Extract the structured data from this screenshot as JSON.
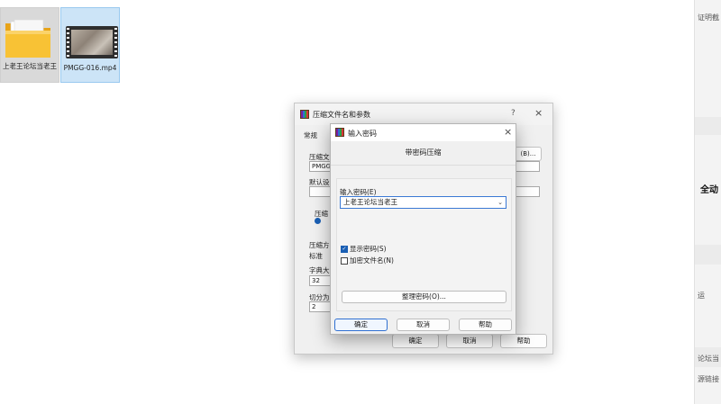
{
  "desktop": {
    "items": [
      {
        "label": "上老王论坛当老王",
        "icon": "folder-icon"
      },
      {
        "label": "PMGG-016.mp4",
        "icon": "video-file-icon"
      }
    ]
  },
  "right_panel": {
    "texts": [
      "证明截",
      "全动",
      "运",
      "论坛当",
      "源链接"
    ]
  },
  "back_dialog": {
    "title": "压缩文件名和参数",
    "help": "?",
    "close": "×",
    "tab": "常规",
    "labels": {
      "archive_name": "压缩文",
      "archive_value": "PMGG-",
      "browse": "(B)...",
      "default": "默认设",
      "format": "压缩",
      "method": "压缩方",
      "method_value": "标准",
      "dict": "字典大",
      "dict_value": "32",
      "split": "切分为",
      "split_value": "2"
    },
    "buttons": {
      "ok": "确定",
      "cancel": "取消",
      "help": "帮助"
    }
  },
  "front_dialog": {
    "title": "输入密码",
    "close": "×",
    "heading": "带密码压缩",
    "password_label": "输入密码(E)",
    "password_value": "上老王论坛当老王",
    "show_password": "显示密码(S)",
    "encrypt_names": "加密文件名(N)",
    "organize_button": "整理密码(O)...",
    "buttons": {
      "ok": "确定",
      "cancel": "取消",
      "help": "帮助"
    },
    "show_password_checked": true,
    "encrypt_names_checked": false
  }
}
